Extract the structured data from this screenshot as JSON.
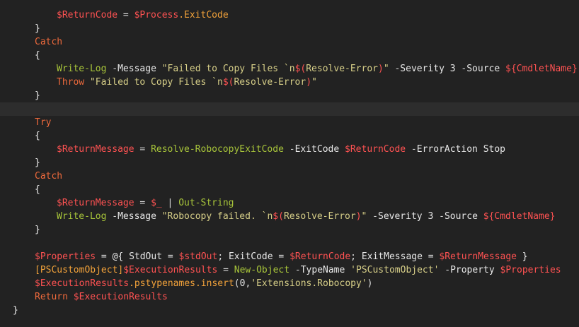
{
  "lines": [
    {
      "indent": 80,
      "tokens": [
        [
          "var",
          "$ReturnCode"
        ],
        [
          "op",
          " = "
        ],
        [
          "var",
          "$Process"
        ],
        [
          "sig",
          ".ExitCode"
        ]
      ]
    },
    {
      "indent": 49,
      "tokens": [
        [
          "brace",
          "}"
        ]
      ]
    },
    {
      "indent": 49,
      "tokens": [
        [
          "kw",
          "Catch"
        ]
      ]
    },
    {
      "indent": 49,
      "tokens": [
        [
          "brace",
          "{"
        ]
      ]
    },
    {
      "indent": 80,
      "tokens": [
        [
          "cmd",
          "Write-Log"
        ],
        [
          "op",
          " -"
        ],
        [
          "param",
          "Message "
        ],
        [
          "str",
          "\"Failed to Copy Files `n"
        ],
        [
          "var",
          "$("
        ],
        [
          "str",
          "Resolve-Error"
        ],
        [
          "var",
          ")"
        ],
        [
          "str",
          "\""
        ],
        [
          "op",
          " -"
        ],
        [
          "param",
          "Severity "
        ],
        [
          "num",
          "3"
        ],
        [
          "op",
          " -"
        ],
        [
          "param",
          "Source "
        ],
        [
          "var",
          "${"
        ],
        [
          "var",
          "CmdletName"
        ],
        [
          "var",
          "}"
        ]
      ]
    },
    {
      "indent": 80,
      "tokens": [
        [
          "kw",
          "Throw"
        ],
        [
          "str",
          " \"Failed to Copy Files `n"
        ],
        [
          "var",
          "$("
        ],
        [
          "str",
          "Resolve-Error"
        ],
        [
          "var",
          ")"
        ],
        [
          "str",
          "\""
        ]
      ]
    },
    {
      "indent": 49,
      "tokens": [
        [
          "brace",
          "}"
        ]
      ]
    },
    {
      "indent": 0,
      "highlight": true,
      "tokens": []
    },
    {
      "indent": 49,
      "tokens": [
        [
          "kw",
          "Try"
        ]
      ]
    },
    {
      "indent": 49,
      "tokens": [
        [
          "brace",
          "{"
        ]
      ]
    },
    {
      "indent": 80,
      "tokens": [
        [
          "var",
          "$ReturnMessage"
        ],
        [
          "op",
          " = "
        ],
        [
          "cmd",
          "Resolve-RobocopyExitCode"
        ],
        [
          "op",
          " -"
        ],
        [
          "param",
          "ExitCode "
        ],
        [
          "var",
          "$ReturnCode"
        ],
        [
          "op",
          " -"
        ],
        [
          "param",
          "ErrorAction "
        ],
        [
          "plain",
          "Stop"
        ]
      ]
    },
    {
      "indent": 49,
      "tokens": [
        [
          "brace",
          "}"
        ]
      ]
    },
    {
      "indent": 49,
      "tokens": [
        [
          "kw",
          "Catch"
        ]
      ]
    },
    {
      "indent": 49,
      "tokens": [
        [
          "brace",
          "{"
        ]
      ]
    },
    {
      "indent": 80,
      "tokens": [
        [
          "var",
          "$ReturnMessage"
        ],
        [
          "op",
          " = "
        ],
        [
          "var",
          "$_"
        ],
        [
          "op",
          " | "
        ],
        [
          "cmd",
          "Out-String"
        ]
      ]
    },
    {
      "indent": 80,
      "tokens": [
        [
          "cmd",
          "Write-Log"
        ],
        [
          "op",
          " -"
        ],
        [
          "param",
          "Message "
        ],
        [
          "str",
          "\"Robocopy failed. `n"
        ],
        [
          "var",
          "$("
        ],
        [
          "str",
          "Resolve-Error"
        ],
        [
          "var",
          ")"
        ],
        [
          "str",
          "\""
        ],
        [
          "op",
          " -"
        ],
        [
          "param",
          "Severity "
        ],
        [
          "num",
          "3"
        ],
        [
          "op",
          " -"
        ],
        [
          "param",
          "Source "
        ],
        [
          "var",
          "${"
        ],
        [
          "var",
          "CmdletName"
        ],
        [
          "var",
          "}"
        ]
      ]
    },
    {
      "indent": 49,
      "tokens": [
        [
          "brace",
          "}"
        ]
      ]
    },
    {
      "indent": 0,
      "tokens": []
    },
    {
      "indent": 49,
      "tokens": [
        [
          "var",
          "$Properties"
        ],
        [
          "op",
          " = "
        ],
        [
          "brace",
          "@{ "
        ],
        [
          "plain",
          "StdOut"
        ],
        [
          "op",
          " = "
        ],
        [
          "var",
          "$stdOut"
        ],
        [
          "punc",
          "; "
        ],
        [
          "plain",
          "ExitCode"
        ],
        [
          "op",
          " = "
        ],
        [
          "var",
          "$ReturnCode"
        ],
        [
          "punc",
          "; "
        ],
        [
          "plain",
          "ExitMessage"
        ],
        [
          "op",
          " = "
        ],
        [
          "var",
          "$ReturnMessage"
        ],
        [
          "brace",
          " }"
        ]
      ]
    },
    {
      "indent": 49,
      "tokens": [
        [
          "type",
          "[PSCustomObject]"
        ],
        [
          "var",
          "$ExecutionResults"
        ],
        [
          "op",
          " = "
        ],
        [
          "cmd",
          "New-Object"
        ],
        [
          "op",
          " -"
        ],
        [
          "param",
          "TypeName "
        ],
        [
          "str",
          "'PSCustomObject'"
        ],
        [
          "op",
          " -"
        ],
        [
          "param",
          "Property "
        ],
        [
          "var",
          "$Properties"
        ]
      ]
    },
    {
      "indent": 49,
      "tokens": [
        [
          "var",
          "$ExecutionResults"
        ],
        [
          "sig",
          ".pstypenames.insert"
        ],
        [
          "punc",
          "("
        ],
        [
          "num",
          "0"
        ],
        [
          "punc",
          ","
        ],
        [
          "str",
          "'Extensions.Robocopy'"
        ],
        [
          "punc",
          ")"
        ]
      ]
    },
    {
      "indent": 49,
      "tokens": [
        [
          "kw",
          "Return "
        ],
        [
          "var",
          "$ExecutionResults"
        ]
      ]
    },
    {
      "indent": 18,
      "tokens": [
        [
          "brace",
          "}"
        ]
      ]
    }
  ]
}
